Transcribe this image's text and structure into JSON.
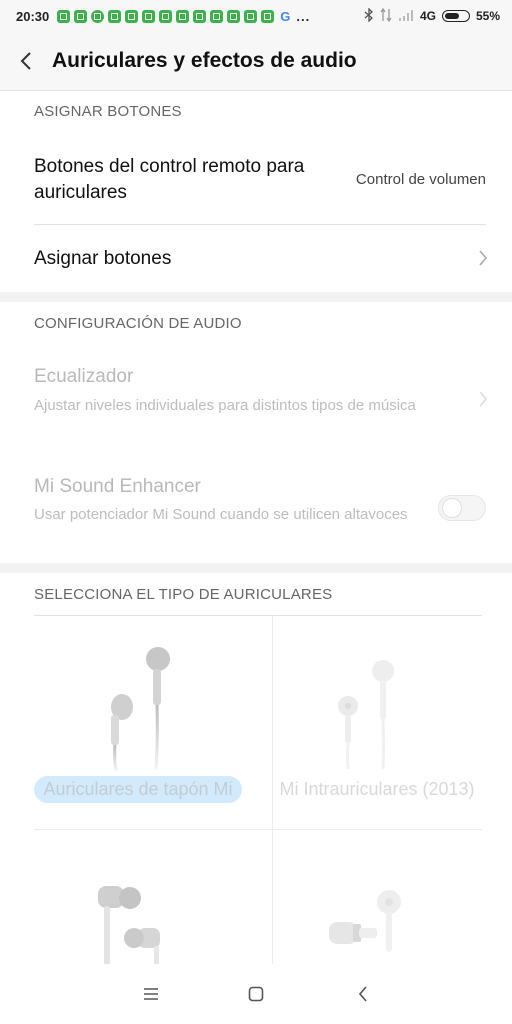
{
  "status_bar": {
    "time": "20:30",
    "network": "4G",
    "battery": "55%",
    "more": "...",
    "google_letter": "G"
  },
  "header": {
    "title": "Auriculares y efectos de audio"
  },
  "assign_section": {
    "header": "ASIGNAR BOTONES",
    "remote_label": "Botones del control remoto para auriculares",
    "remote_value": "Control de volumen",
    "assign_label": "Asignar botones"
  },
  "audio_section": {
    "header": "CONFIGURACIÓN DE AUDIO",
    "equalizer_title": "Ecualizador",
    "equalizer_sub": "Ajustar niveles individuales para distintos tipos de música",
    "enhancer_title": "Mi Sound Enhancer",
    "enhancer_sub": "Usar potenciador Mi Sound cuando se utilicen altavoces",
    "enhancer_on": false
  },
  "headphone_section": {
    "header": "SELECCIONA EL TIPO DE AURICULARES",
    "options": [
      {
        "label": "Auriculares de tapón Mi",
        "selected": true
      },
      {
        "label": "Mi Intrauriculares (2013)",
        "selected": false
      }
    ]
  },
  "colors": {
    "selected_bg": "#d2eafb",
    "status_icon_green": "#3cb34a"
  }
}
